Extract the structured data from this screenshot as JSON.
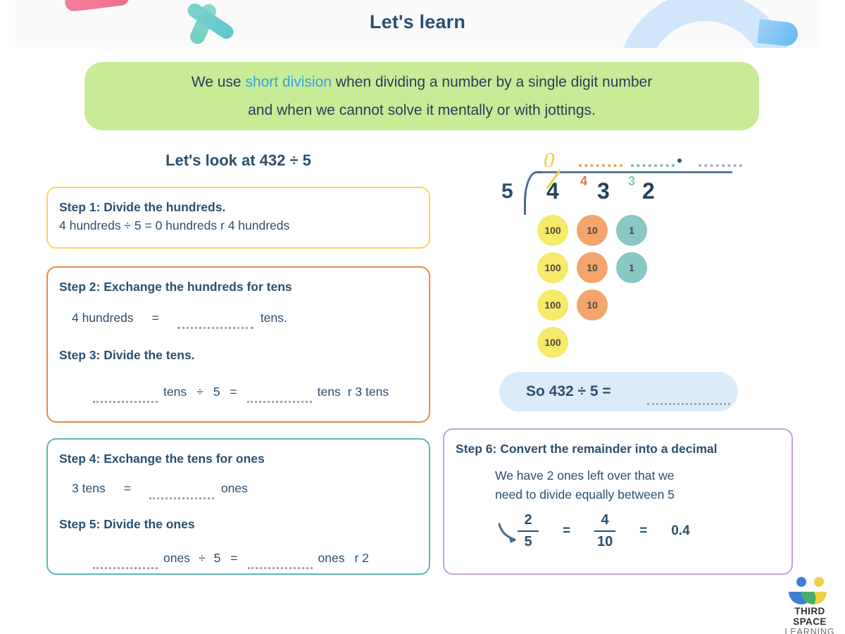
{
  "header": {
    "title": "Let's learn"
  },
  "banner": {
    "line1_a": "We use ",
    "line1_hl": "short division",
    "line1_b": " when dividing a number by a single digit number",
    "line2": "and when we cannot solve it mentally or with jottings."
  },
  "lets_look": "Let's look at 432 ÷ 5",
  "steps": {
    "step1": {
      "title": "Step 1: Divide the hundreds.",
      "line": "4 hundreds ÷ 5 = 0 hundreds r 4 hundreds",
      "border_color": "#fbd55f"
    },
    "step2": {
      "title": "Step 2: Exchange the hundreds for tens",
      "left": "4 hundreds",
      "equals": "=",
      "unit": "tens.",
      "border_color": "#ec8b46"
    },
    "step3": {
      "title": "Step 3: Divide the tens.",
      "unit_a": "tens",
      "divide": "÷",
      "divisor": "5",
      "equals": "=",
      "unit_b": "tens",
      "remainder": "r 3 tens"
    },
    "step4": {
      "title": "Step 4: Exchange the tens for ones",
      "left": "3 tens",
      "equals": "=",
      "unit": "ones",
      "border_color": "#5fb8b2"
    },
    "step5": {
      "title": "Step 5: Divide the ones",
      "unit_a": "ones",
      "divide": "÷",
      "divisor": "5",
      "equals": "=",
      "unit_b": "ones",
      "remainder": "r 2"
    },
    "step6": {
      "title": "Step 6: Convert the remainder into a decimal",
      "line1": "We have 2 ones left over that we",
      "line2": "need to divide equally between 5",
      "frac1_num": "2",
      "frac1_den": "5",
      "eq1": "=",
      "frac2_num": "4",
      "frac2_den": "10",
      "eq2": "=",
      "decimal": "0.4",
      "border_color": "#c2a2dd"
    }
  },
  "division": {
    "divisor": "5",
    "quotient_digit": "0",
    "dividend_digits": [
      "4",
      "3",
      "2"
    ],
    "carry_marks": [
      {
        "value": "4",
        "color": "#e8743b"
      },
      {
        "value": "3",
        "color": "#7ec9c2"
      }
    ],
    "decimal_point": "."
  },
  "counters": {
    "rows": [
      [
        "100",
        "10",
        "1"
      ],
      [
        "100",
        "10",
        "1"
      ],
      [
        "100",
        "10",
        ""
      ],
      [
        "100",
        "",
        ""
      ]
    ],
    "colors": {
      "hundred": "#f7e96a",
      "ten": "#f3a56c",
      "one": "#89c8c4"
    }
  },
  "so_box": {
    "text": "So  432 ÷ 5 =",
    "background": "#dcebf8"
  },
  "logo": {
    "line1": "THIRD SPACE",
    "line2": "LEARNING"
  }
}
